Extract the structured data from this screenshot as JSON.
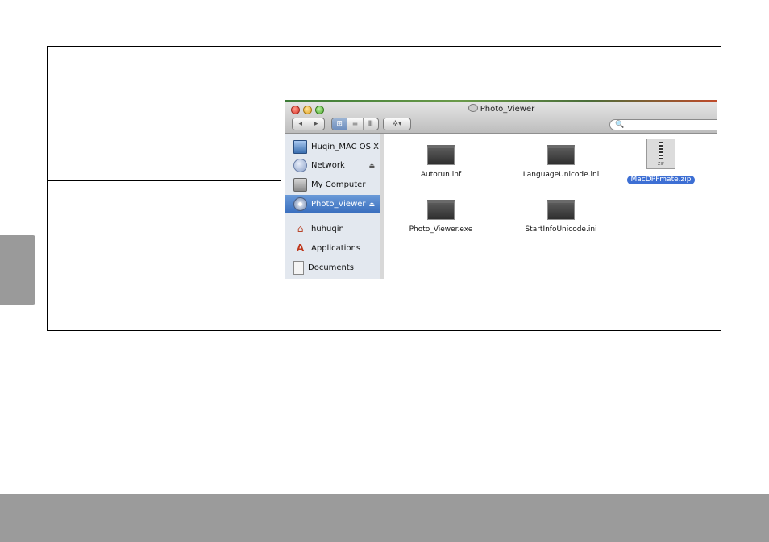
{
  "finder": {
    "window_title": "Photo_Viewer",
    "toolbar": {
      "back_icon": "◂",
      "forward_icon": "▸",
      "icon_view_icon": "⊞",
      "list_view_icon": "≡",
      "column_view_icon": "Ⅲ",
      "action_icon": "✲▾",
      "search_icon": "🔍"
    },
    "sidebar": {
      "items": [
        {
          "label": "Huqin_MAC OS X",
          "icon": "screen-icon"
        },
        {
          "label": "Network",
          "icon": "globe-icon",
          "eject": "⏏"
        },
        {
          "label": "My Computer",
          "icon": "computer-icon"
        },
        {
          "label": "Photo_Viewer",
          "icon": "disc-icon",
          "eject": "⏏",
          "selected": true
        },
        {
          "label": "huhuqin",
          "icon": "home-icon"
        },
        {
          "label": "Applications",
          "icon": "applications-icon"
        },
        {
          "label": "Documents",
          "icon": "documents-icon"
        }
      ]
    },
    "files": [
      {
        "name": "Autorun.inf"
      },
      {
        "name": "LanguageUnicode.ini"
      },
      {
        "name": "MacDPFmate.zip",
        "selected": true,
        "badge": "ZIP"
      },
      {
        "name": "Photo_Viewer.exe"
      },
      {
        "name": "StartInfoUnicode.ini"
      }
    ]
  },
  "colors": {
    "selection": "#3d6fd4",
    "side_tab": "#9a9a9a",
    "footer_bar": "#9b9b9b"
  }
}
